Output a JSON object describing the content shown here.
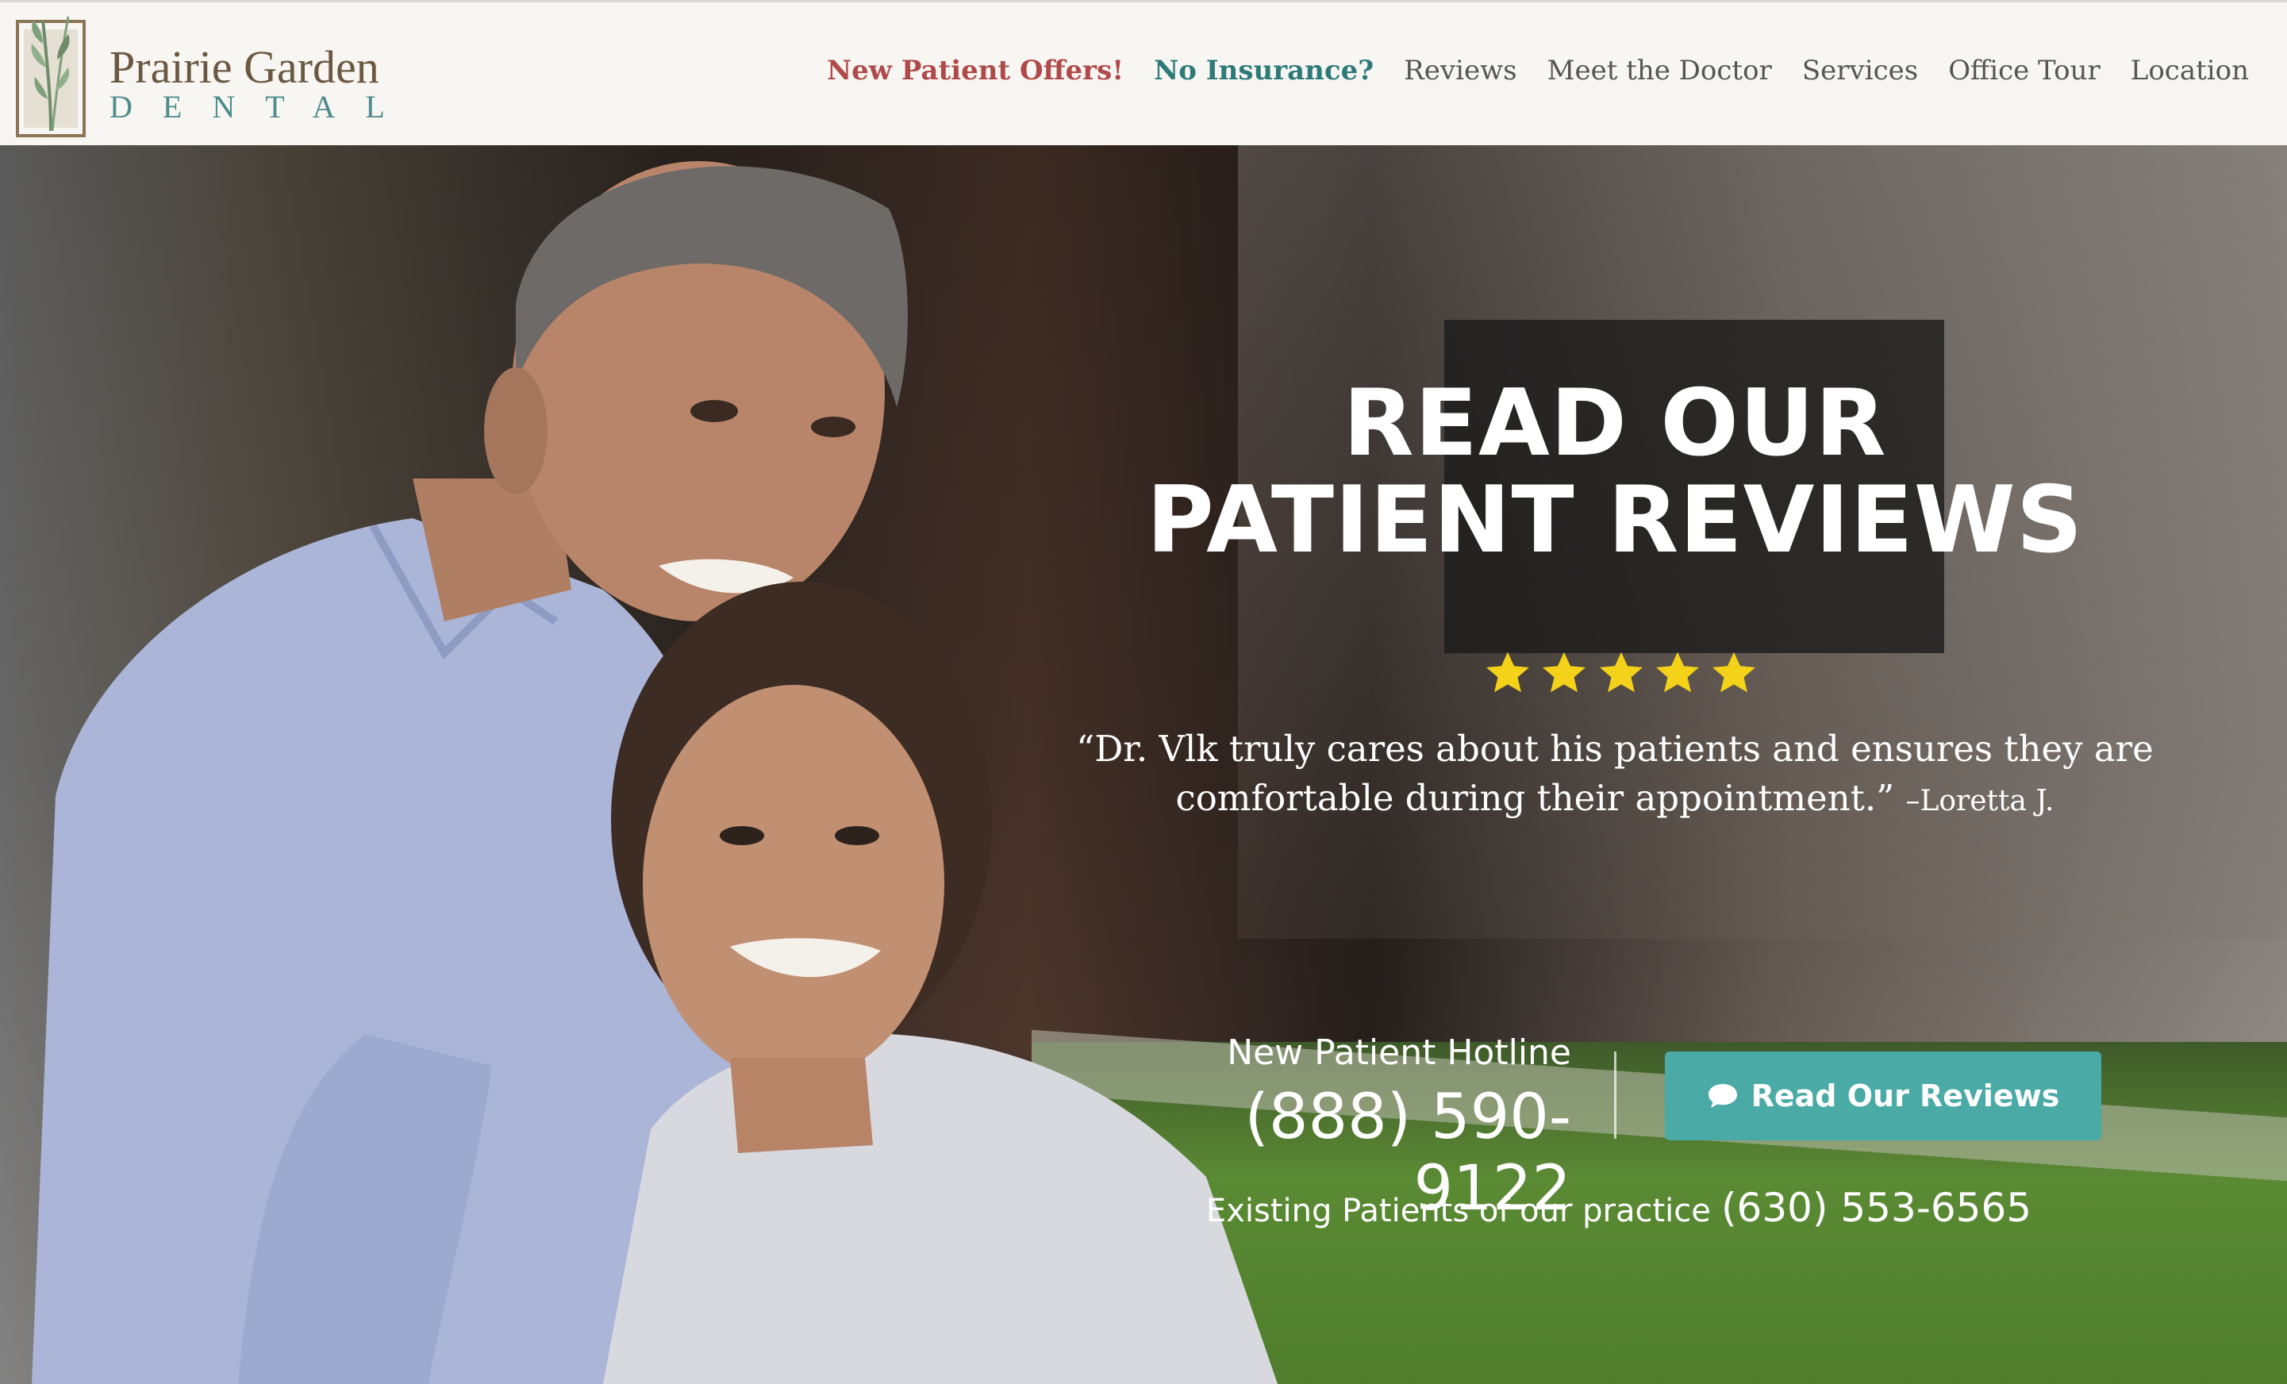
{
  "brand": {
    "name_line1": "Prairie Garden",
    "name_line2": "DENTAL",
    "colors": {
      "brown": "#6b5841",
      "teal": "#4e8c8c"
    }
  },
  "nav": {
    "items": [
      {
        "label": "New Patient Offers!",
        "style": "offer"
      },
      {
        "label": "No Insurance?",
        "style": "noins"
      },
      {
        "label": "Reviews"
      },
      {
        "label": "Meet the Doctor"
      },
      {
        "label": "Services"
      },
      {
        "label": "Office Tour"
      },
      {
        "label": "Location"
      }
    ],
    "colors": {
      "offer": "#b04a4a",
      "noins": "#2e7a78",
      "default": "#555555"
    }
  },
  "hero": {
    "title_line1": "READ OUR",
    "title_line2": "PATIENT REVIEWS",
    "rating": {
      "stars": 5,
      "max": 5,
      "color": "#f4d21a"
    },
    "quote": "“Dr. Vlk truly cares about his patients and ensures they are comfortable during their appointment.”",
    "quote_author": "–Loretta J.",
    "hotline_label": "New Patient Hotline",
    "hotline_number": "(888) 590-9122",
    "reviews_button_label": "Read Our Reviews",
    "reviews_button_icon": "chat-bubble-icon",
    "reviews_button_color": "#4aaaa6",
    "existing_label": "Existing Patients of our practice",
    "existing_phone": "(630) 553-6565"
  }
}
